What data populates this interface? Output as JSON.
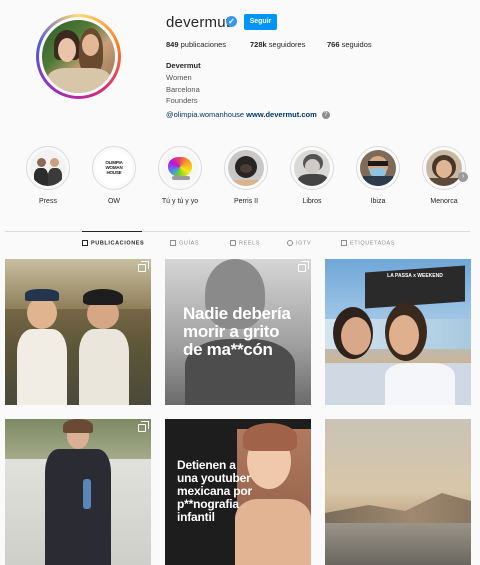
{
  "profile": {
    "username": "devermut",
    "verified_icon": "verified-badge-icon",
    "follow_label": "Seguir",
    "stats": {
      "posts_count": "849",
      "posts_label": "publicaciones",
      "followers_count": "728k",
      "followers_label": "seguidores",
      "following_count": "766",
      "following_label": "seguidos"
    },
    "bio": {
      "name": "Devermut",
      "lines": [
        "Women",
        "Barcelona",
        "Founders"
      ],
      "mention": "@olimpia.womanhouse",
      "website": "www.devermut.com"
    }
  },
  "highlights": [
    {
      "label": "Press"
    },
    {
      "label": "OW",
      "logo_text": "OLIMPIA WOMAN HOUSE"
    },
    {
      "label": "Tú y tú y yo"
    },
    {
      "label": "Perris II"
    },
    {
      "label": "Libros"
    },
    {
      "label": "Ibiza"
    },
    {
      "label": "Menorca"
    }
  ],
  "tabs": [
    {
      "label": "PUBLICACIONES",
      "active": true
    },
    {
      "label": "GUÍAS"
    },
    {
      "label": "REELS"
    },
    {
      "label": "IGTV"
    },
    {
      "label": "ETIQUETADAS"
    }
  ],
  "posts": [
    {
      "caption": "",
      "multi": true
    },
    {
      "caption": "Nadie debería morir a grito de ma**cón",
      "lines": [
        "Nadie debería",
        "morir a grito",
        "de ma**cón"
      ],
      "multi": true
    },
    {
      "caption": "",
      "sign": "LA PASSA x WEEKEND",
      "multi": false
    },
    {
      "caption": "",
      "multi": true
    },
    {
      "caption": "Detienen a una youtuber mexicana por p**nografía infantil",
      "lines": [
        "Detienen a",
        "una youtuber",
        "mexicana por",
        "p**nografia",
        "infantil"
      ],
      "multi": false
    },
    {
      "caption": "",
      "multi": false
    }
  ],
  "colors": {
    "accent": "#0095f6",
    "link": "#00376b",
    "text": "#262626",
    "muted": "#8e8e8e"
  }
}
